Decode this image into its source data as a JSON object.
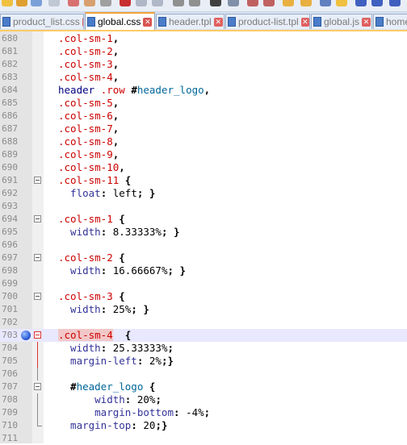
{
  "tabs": [
    {
      "label": "product_list.css",
      "active": false,
      "icon": "css-file-icon"
    },
    {
      "label": "global.css",
      "active": true,
      "icon": "css-file-icon"
    },
    {
      "label": "header.tpl",
      "active": false,
      "icon": "tpl-file-icon"
    },
    {
      "label": "product-list.tpl",
      "active": false,
      "icon": "tpl-file-icon"
    },
    {
      "label": "global.js",
      "active": false,
      "icon": "js-file-icon"
    },
    {
      "label": "home",
      "active": false,
      "icon": "file-icon"
    }
  ],
  "close_glyph": "✕",
  "lines": [
    {
      "n": "680",
      "c": [
        {
          "t": ".col-sm-1",
          "k": "sel"
        },
        {
          "t": ",",
          "k": "punc"
        }
      ]
    },
    {
      "n": "681",
      "c": [
        {
          "t": ".col-sm-2",
          "k": "sel"
        },
        {
          "t": ",",
          "k": "punc"
        }
      ]
    },
    {
      "n": "682",
      "c": [
        {
          "t": ".col-sm-3",
          "k": "sel"
        },
        {
          "t": ",",
          "k": "punc"
        }
      ]
    },
    {
      "n": "683",
      "c": [
        {
          "t": ".col-sm-4",
          "k": "sel"
        },
        {
          "t": ",",
          "k": "punc"
        }
      ]
    },
    {
      "n": "684",
      "c": [
        {
          "t": "header ",
          "k": "tag"
        },
        {
          "t": ".row ",
          "k": "cls"
        },
        {
          "t": "#",
          "k": "punc"
        },
        {
          "t": "header_logo",
          "k": "idsel"
        },
        {
          "t": ",",
          "k": "punc"
        }
      ]
    },
    {
      "n": "685",
      "c": [
        {
          "t": ".col-sm-5",
          "k": "sel"
        },
        {
          "t": ",",
          "k": "punc"
        }
      ]
    },
    {
      "n": "686",
      "c": [
        {
          "t": ".col-sm-6",
          "k": "sel"
        },
        {
          "t": ",",
          "k": "punc"
        }
      ]
    },
    {
      "n": "687",
      "c": [
        {
          "t": ".col-sm-7",
          "k": "sel"
        },
        {
          "t": ",",
          "k": "punc"
        }
      ]
    },
    {
      "n": "688",
      "c": [
        {
          "t": ".col-sm-8",
          "k": "sel"
        },
        {
          "t": ",",
          "k": "punc"
        }
      ]
    },
    {
      "n": "689",
      "c": [
        {
          "t": ".col-sm-9",
          "k": "sel"
        },
        {
          "t": ",",
          "k": "punc"
        }
      ]
    },
    {
      "n": "690",
      "c": [
        {
          "t": ".col-sm-10",
          "k": "sel"
        },
        {
          "t": ",",
          "k": "punc"
        }
      ]
    },
    {
      "n": "691",
      "fold": "open",
      "c": [
        {
          "t": ".col-sm-11 ",
          "k": "sel"
        },
        {
          "t": "{",
          "k": "punc"
        }
      ]
    },
    {
      "n": "692",
      "c": [
        {
          "t": "  float",
          "k": "prop"
        },
        {
          "t": ": ",
          "k": "punc"
        },
        {
          "t": "left",
          "k": "plain"
        },
        {
          "t": "; }",
          "k": "punc"
        }
      ]
    },
    {
      "n": "693",
      "c": []
    },
    {
      "n": "694",
      "fold": "open",
      "c": [
        {
          "t": ".col-sm-1 ",
          "k": "sel"
        },
        {
          "t": "{",
          "k": "punc"
        }
      ]
    },
    {
      "n": "695",
      "c": [
        {
          "t": "  width",
          "k": "prop"
        },
        {
          "t": ": ",
          "k": "punc"
        },
        {
          "t": "8.33333%",
          "k": "plain"
        },
        {
          "t": "; }",
          "k": "punc"
        }
      ]
    },
    {
      "n": "696",
      "c": []
    },
    {
      "n": "697",
      "fold": "open",
      "c": [
        {
          "t": ".col-sm-2 ",
          "k": "sel"
        },
        {
          "t": "{",
          "k": "punc"
        }
      ]
    },
    {
      "n": "698",
      "c": [
        {
          "t": "  width",
          "k": "prop"
        },
        {
          "t": ": ",
          "k": "punc"
        },
        {
          "t": "16.66667%",
          "k": "plain"
        },
        {
          "t": "; }",
          "k": "punc"
        }
      ]
    },
    {
      "n": "699",
      "c": []
    },
    {
      "n": "700",
      "fold": "open",
      "c": [
        {
          "t": ".col-sm-3 ",
          "k": "sel"
        },
        {
          "t": "{",
          "k": "punc"
        }
      ]
    },
    {
      "n": "701",
      "c": [
        {
          "t": "  width",
          "k": "prop"
        },
        {
          "t": ": ",
          "k": "punc"
        },
        {
          "t": "25%",
          "k": "plain"
        },
        {
          "t": "; }",
          "k": "punc"
        }
      ]
    },
    {
      "n": "702",
      "c": []
    },
    {
      "n": "703",
      "fold": "open-red",
      "bookmark": true,
      "current": true,
      "c": [
        {
          "t": ".col-sm-4",
          "k": "selhl"
        },
        {
          "t": "  {",
          "k": "punc"
        }
      ]
    },
    {
      "n": "704",
      "fold": "line-red",
      "c": [
        {
          "t": "  width",
          "k": "prop"
        },
        {
          "t": ": ",
          "k": "punc"
        },
        {
          "t": "25.33333%",
          "k": "plain"
        },
        {
          "t": ";",
          "k": "punc"
        }
      ]
    },
    {
      "n": "705",
      "fold": "line-red",
      "c": [
        {
          "t": "  margin-left",
          "k": "prop"
        },
        {
          "t": ": ",
          "k": "punc"
        },
        {
          "t": "2%",
          "k": "plain"
        },
        {
          "t": ";}",
          "k": "punc"
        }
      ]
    },
    {
      "n": "706",
      "fold": "line",
      "c": []
    },
    {
      "n": "707",
      "fold": "open",
      "c": [
        {
          "t": "  #",
          "k": "punc"
        },
        {
          "t": "header_logo ",
          "k": "idsel"
        },
        {
          "t": "{",
          "k": "punc"
        }
      ]
    },
    {
      "n": "708",
      "fold": "line",
      "c": [
        {
          "t": "      width",
          "k": "prop"
        },
        {
          "t": ": ",
          "k": "punc"
        },
        {
          "t": "20%",
          "k": "plain"
        },
        {
          "t": ";",
          "k": "punc"
        }
      ]
    },
    {
      "n": "709",
      "fold": "line",
      "c": [
        {
          "t": "      margin-bottom",
          "k": "prop"
        },
        {
          "t": ": ",
          "k": "punc"
        },
        {
          "t": "-4%",
          "k": "plain"
        },
        {
          "t": ";",
          "k": "punc"
        }
      ]
    },
    {
      "n": "710",
      "fold": "end",
      "c": [
        {
          "t": "  margin-top",
          "k": "prop"
        },
        {
          "t": ": ",
          "k": "punc"
        },
        {
          "t": "20",
          "k": "plain"
        },
        {
          "t": ";}",
          "k": "punc"
        }
      ]
    },
    {
      "n": "711",
      "c": []
    }
  ]
}
